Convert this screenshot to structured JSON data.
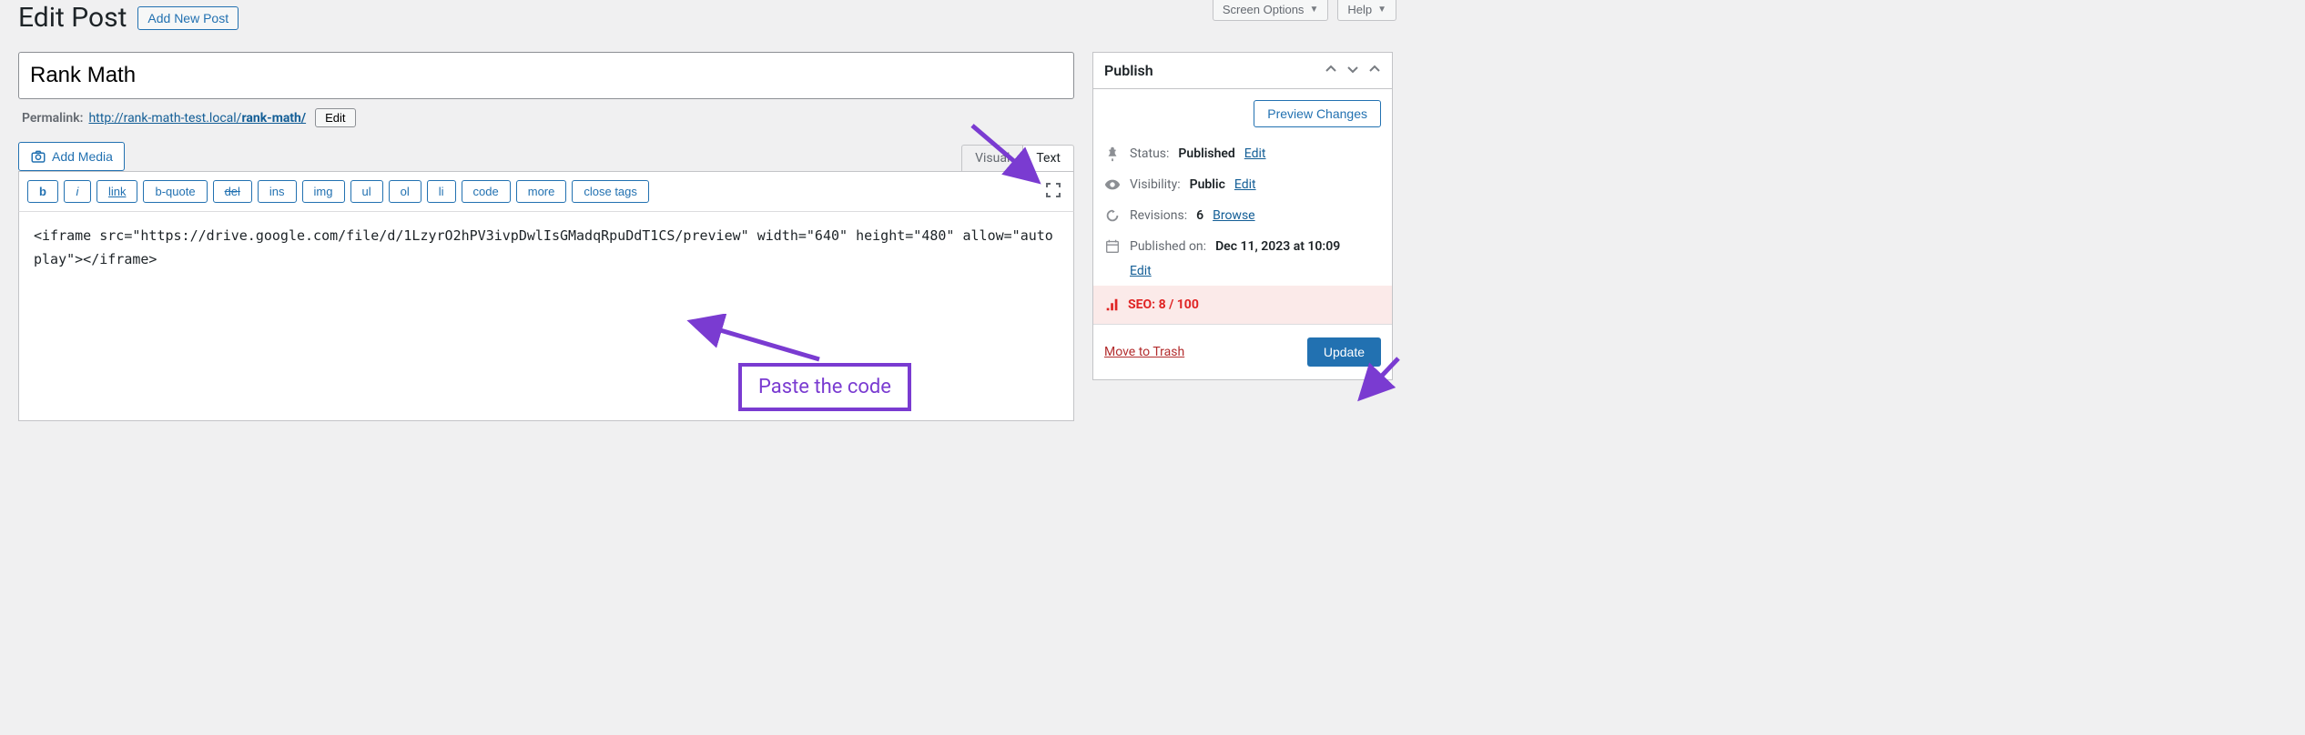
{
  "topButtons": {
    "screenOptions": "Screen Options",
    "help": "Help"
  },
  "header": {
    "pageTitle": "Edit Post",
    "addNew": "Add New Post"
  },
  "post": {
    "title": "Rank Math",
    "permalinkLabel": "Permalink:",
    "permalinkBase": "http://rank-math-test.local/",
    "permalinkSlug": "rank-math/",
    "editSlugLabel": "Edit"
  },
  "editor": {
    "addMedia": "Add Media",
    "tabs": {
      "visual": "Visual",
      "text": "Text"
    },
    "quicktags": [
      "b",
      "i",
      "link",
      "b-quote",
      "del",
      "ins",
      "img",
      "ul",
      "ol",
      "li",
      "code",
      "more",
      "close tags"
    ],
    "content": "<iframe src=\"https://drive.google.com/file/d/1LzyrO2hPV3ivpDwlIsGMadqRpuDdT1CS/preview\" width=\"640\" height=\"480\" allow=\"autoplay\"></iframe>"
  },
  "publish": {
    "title": "Publish",
    "previewChanges": "Preview Changes",
    "statusLabel": "Status:",
    "statusValue": "Published",
    "statusEdit": "Edit",
    "visibilityLabel": "Visibility:",
    "visibilityValue": "Public",
    "visibilityEdit": "Edit",
    "revisionsLabel": "Revisions:",
    "revisionsValue": "6",
    "revisionsBrowse": "Browse",
    "publishedOnLabel": "Published on:",
    "publishedOnValue": "Dec 11, 2023 at 10:09",
    "publishedOnEdit": "Edit",
    "seoLabel": "SEO: 8 / 100",
    "trash": "Move to Trash",
    "update": "Update"
  },
  "annotation": {
    "callout": "Paste the code"
  }
}
